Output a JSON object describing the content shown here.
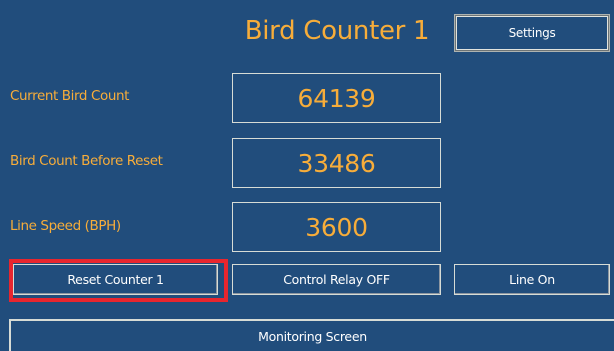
{
  "header": {
    "title": "Bird Counter 1",
    "settings_label": "Settings"
  },
  "readouts": [
    {
      "label": "Current Bird Count",
      "value": "64139"
    },
    {
      "label": "Bird Count Before Reset",
      "value": "33486"
    },
    {
      "label": "Line Speed (BPH)",
      "value": "3600"
    }
  ],
  "controls": {
    "reset_label": "Reset Counter 1",
    "relay_label": "Control Relay OFF",
    "line_label": "Line On"
  },
  "footer": {
    "screen_label": "Monitoring Screen"
  },
  "colors": {
    "background": "#214d7c",
    "accent": "#f7ad3a",
    "highlight": "#e8262e"
  }
}
